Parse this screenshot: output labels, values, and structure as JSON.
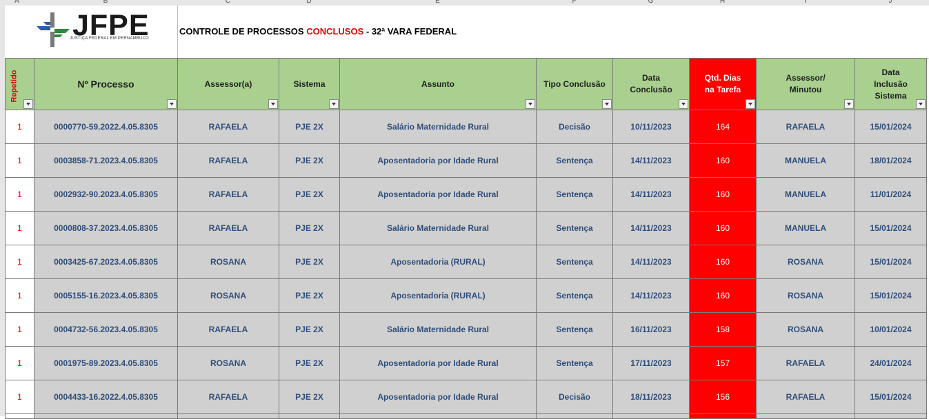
{
  "column_letters": [
    "A",
    "B",
    "C",
    "D",
    "E",
    "F",
    "G",
    "H",
    "I",
    "J"
  ],
  "logo": {
    "text": "JFPE",
    "subtitle": "JUSTIÇA FEDERAL EM PERNAMBUCO"
  },
  "title": {
    "prefix": "CONTROLE DE PROCESSOS ",
    "highlight": "CONCLUSOS",
    "suffix": " - 32ª VARA FEDERAL"
  },
  "colors": {
    "header_green": "#a9d08e",
    "days_red": "#ff0000",
    "cell_gray": "#d0d0d0",
    "cell_text": "#2f4e7a"
  },
  "headers": {
    "repetido": "Repetido",
    "processo": "Nº Processo",
    "assessor": "Assessor(a)",
    "sistema": "Sistema",
    "assunto": "Assunto",
    "tipo": "Tipo Conclusão",
    "data_conclusao": "Data Conclusão",
    "qtd_dias": "Qtd. Dias na Tarefa",
    "minutou": "Assessor/ Minutou",
    "data_inclusao": "Data Inclusão Sistema"
  },
  "rows": [
    {
      "repetido": "1",
      "processo": "0000770-59.2022.4.05.8305",
      "assessor": "RAFAELA",
      "sistema": "PJE 2X",
      "assunto": "Salário Maternidade Rural",
      "tipo": "Decisão",
      "data_conclusao": "10/11/2023",
      "dias": "164",
      "minutou": "RAFAELA",
      "data_inclusao": "15/01/2024"
    },
    {
      "repetido": "1",
      "processo": "0003858-71.2023.4.05.8305",
      "assessor": "RAFAELA",
      "sistema": "PJE 2X",
      "assunto": "Aposentadoria por Idade Rural",
      "tipo": "Sentença",
      "data_conclusao": "14/11/2023",
      "dias": "160",
      "minutou": "MANUELA",
      "data_inclusao": "18/01/2024"
    },
    {
      "repetido": "1",
      "processo": "0002932-90.2023.4.05.8305",
      "assessor": "RAFAELA",
      "sistema": "PJE 2X",
      "assunto": "Aposentadoria por Idade Rural",
      "tipo": "Sentença",
      "data_conclusao": "14/11/2023",
      "dias": "160",
      "minutou": "MANUELA",
      "data_inclusao": "11/01/2024"
    },
    {
      "repetido": "1",
      "processo": "0000808-37.2023.4.05.8305",
      "assessor": "RAFAELA",
      "sistema": "PJE 2X",
      "assunto": "Salário Maternidade Rural",
      "tipo": "Sentença",
      "data_conclusao": "14/11/2023",
      "dias": "160",
      "minutou": "MANUELA",
      "data_inclusao": "15/01/2024"
    },
    {
      "repetido": "1",
      "processo": "0003425-67.2023.4.05.8305",
      "assessor": "ROSANA",
      "sistema": "PJE 2X",
      "assunto": "Aposentadoria (RURAL)",
      "tipo": "Sentença",
      "data_conclusao": "14/11/2023",
      "dias": "160",
      "minutou": "ROSANA",
      "data_inclusao": "15/01/2024"
    },
    {
      "repetido": "1",
      "processo": "0005155-16.2023.4.05.8305",
      "assessor": "ROSANA",
      "sistema": "PJE 2X",
      "assunto": "Aposentadoria (RURAL)",
      "tipo": "Sentença",
      "data_conclusao": "14/11/2023",
      "dias": "160",
      "minutou": "ROSANA",
      "data_inclusao": "15/01/2024"
    },
    {
      "repetido": "1",
      "processo": "0004732-56.2023.4.05.8305",
      "assessor": "RAFAELA",
      "sistema": "PJE 2X",
      "assunto": "Salário Maternidade Rural",
      "tipo": "Sentença",
      "data_conclusao": "16/11/2023",
      "dias": "158",
      "minutou": "ROSANA",
      "data_inclusao": "10/01/2024"
    },
    {
      "repetido": "1",
      "processo": "0001975-89.2023.4.05.8305",
      "assessor": "ROSANA",
      "sistema": "PJE 2X",
      "assunto": "Aposentadoria por Idade Rural",
      "tipo": "Sentença",
      "data_conclusao": "17/11/2023",
      "dias": "157",
      "minutou": "RAFAELA",
      "data_inclusao": "24/01/2024"
    },
    {
      "repetido": "1",
      "processo": "0004433-16.2022.4.05.8305",
      "assessor": "RAFAELA",
      "sistema": "PJE 2X",
      "assunto": "Aposentadoria por Idade Rural",
      "tipo": "Decisão",
      "data_conclusao": "18/11/2023",
      "dias": "156",
      "minutou": "RAFAELA",
      "data_inclusao": "15/01/2024"
    }
  ]
}
